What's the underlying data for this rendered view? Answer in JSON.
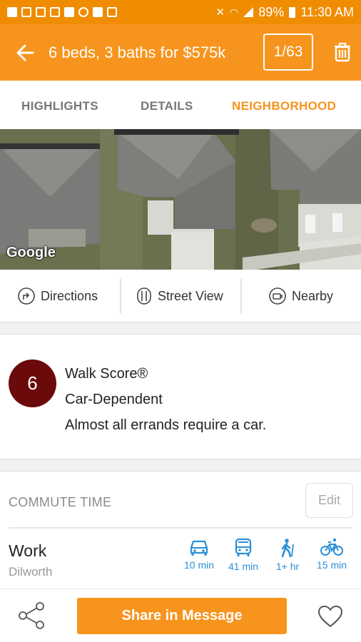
{
  "status_bar": {
    "battery": "89%",
    "time": "11:30 AM"
  },
  "header": {
    "title": "6 beds, 3 baths for $575k",
    "counter": "1/63",
    "back_icon": "arrow-left-icon",
    "trash_icon": "trash-icon"
  },
  "tabs": [
    {
      "label": "HIGHLIGHTS",
      "active": false
    },
    {
      "label": "DETAILS",
      "active": false
    },
    {
      "label": "NEIGHBORHOOD",
      "active": true
    }
  ],
  "map": {
    "attribution": "Google"
  },
  "map_actions": [
    {
      "label": "Directions",
      "icon": "directions-icon"
    },
    {
      "label": "Street View",
      "icon": "street-view-icon"
    },
    {
      "label": "Nearby",
      "icon": "nearby-icon"
    }
  ],
  "walk_score": {
    "score": "6",
    "title": "Walk Score®",
    "category": "Car-Dependent",
    "description": "Almost all errands require a car."
  },
  "commute": {
    "label": "COMMUTE TIME",
    "edit_label": "Edit",
    "destination": "Work",
    "area": "Dilworth",
    "modes": [
      {
        "icon": "car-icon",
        "time": "10 min"
      },
      {
        "icon": "bus-icon",
        "time": "41 min"
      },
      {
        "icon": "walk-icon",
        "time": "1+ hr"
      },
      {
        "icon": "bike-icon",
        "time": "15 min"
      }
    ]
  },
  "bottom_bar": {
    "share_label": "Share in Message",
    "share_icon": "share-icon",
    "favorite_icon": "heart-icon"
  },
  "colors": {
    "accent": "#f7941d",
    "status_bar": "#f08c00",
    "score_circle": "#6b0a0a",
    "commute_blue": "#2b8fd8"
  }
}
